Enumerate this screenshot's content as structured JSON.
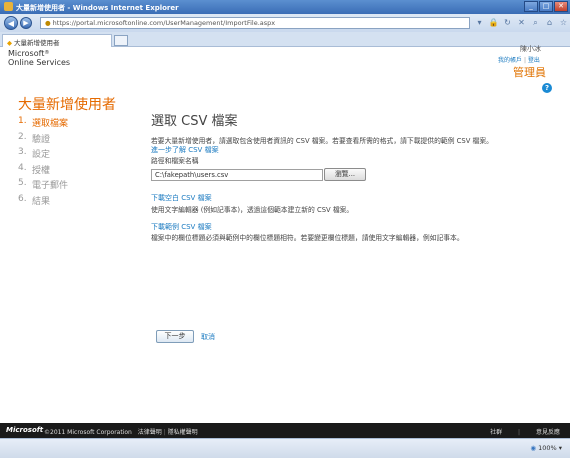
{
  "window": {
    "title": "大量新增使用者 - Windows Internet Explorer",
    "url": "https://portal.microsoftonline.com/UserManagement/ImportFile.aspx",
    "tab_title": "大量新增使用者"
  },
  "header": {
    "logo_line1": "Microsoft",
    "logo_line2": "Online Services",
    "user_name": "陳小冰",
    "user_link_profile": "我的帳戶",
    "user_link_signout": "登出",
    "role": "管理員",
    "help": "?"
  },
  "page": {
    "title": "大量新增使用者",
    "steps": [
      {
        "num": "1.",
        "label": "選取檔案"
      },
      {
        "num": "2.",
        "label": "驗證"
      },
      {
        "num": "3.",
        "label": "設定"
      },
      {
        "num": "4.",
        "label": "授權"
      },
      {
        "num": "5.",
        "label": "電子郵件"
      },
      {
        "num": "6.",
        "label": "結果"
      }
    ]
  },
  "content": {
    "section_title": "選取 CSV 檔案",
    "description": "若要大量新增使用者，請選取包含使用者資訊的 CSV 檔案。若要查看所需的格式，請下載提供的範例 CSV 檔案。",
    "learn_more": "進一步了解 CSV 檔案",
    "path_label": "路徑和檔案名稱",
    "file_value": "C:\\fakepath\\users.csv",
    "browse_label": "瀏覽...",
    "blank_link": "下載空白 CSV 檔案",
    "blank_desc": "使用文字編輯器 (例如記事本)，透過這個範本建立新的 CSV 檔案。",
    "sample_link": "下載範例 CSV 檔案",
    "sample_desc": "檔案中的欄位標題必須與範例中的欄位標題相符。若要變更欄位標題，請使用文字編輯器，例如記事本。",
    "next_label": "下一步",
    "cancel_label": "取消"
  },
  "footer": {
    "logo": "Microsoft",
    "copyright": "©2011 Microsoft Corporation",
    "legal": "法律聲明",
    "privacy": "隱私權聲明",
    "community": "社群",
    "feedback": "意見反應"
  },
  "statusbar": {
    "zoom": "100%"
  }
}
